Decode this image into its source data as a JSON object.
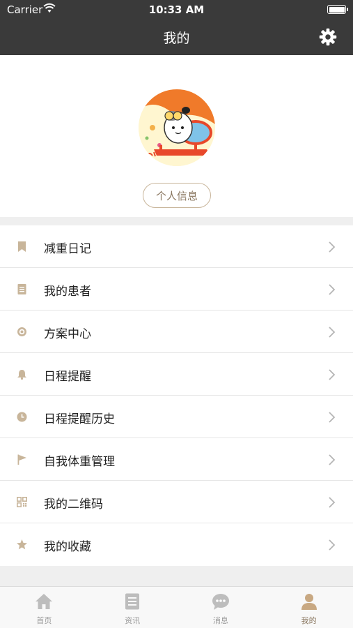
{
  "status_bar": {
    "carrier": "Carrier",
    "time": "10:33 AM"
  },
  "nav": {
    "title": "我的",
    "settings_icon": "gear-icon"
  },
  "profile": {
    "info_button": "个人信息",
    "avatar_icon": "cartoon-avatar"
  },
  "menu": {
    "items": [
      {
        "label": "减重日记",
        "icon": "bookmark-icon"
      },
      {
        "label": "我的患者",
        "icon": "document-icon"
      },
      {
        "label": "方案中心",
        "icon": "target-icon"
      },
      {
        "label": "日程提醒",
        "icon": "bell-icon"
      },
      {
        "label": "日程提醒历史",
        "icon": "clock-icon"
      },
      {
        "label": "自我体重管理",
        "icon": "flag-icon"
      },
      {
        "label": "我的二维码",
        "icon": "qrcode-icon"
      },
      {
        "label": "我的收藏",
        "icon": "star-icon"
      }
    ]
  },
  "tab_bar": {
    "tabs": [
      {
        "label": "首页",
        "icon": "home-icon",
        "active": false
      },
      {
        "label": "资讯",
        "icon": "news-icon",
        "active": false
      },
      {
        "label": "消息",
        "icon": "chat-icon",
        "active": false
      },
      {
        "label": "我的",
        "icon": "person-icon",
        "active": true
      }
    ]
  },
  "colors": {
    "header_bg": "#3a3a3a",
    "accent": "#c8b59a",
    "accent_text": "#8a7760",
    "inactive": "#bdbdbd"
  }
}
